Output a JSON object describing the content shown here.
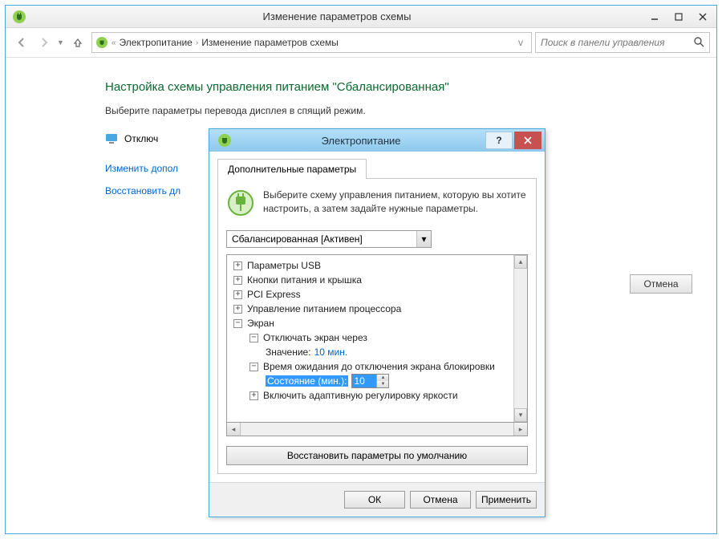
{
  "window": {
    "title": "Изменение параметров схемы",
    "breadcrumb": {
      "p1": "Электропитание",
      "p2": "Изменение параметров схемы"
    },
    "search_placeholder": "Поиск в панели управления"
  },
  "page": {
    "heading": "Настройка схемы управления питанием \"Сбалансированная\"",
    "subtext": "Выберите параметры перевода дисплея в спящий режим.",
    "opt_display_off": "Отключ",
    "link_advanced": "Изменить допол",
    "link_restore": "Восстановить дл",
    "buttons": {
      "cancel": "Отмена"
    }
  },
  "dialog": {
    "title": "Электропитание",
    "tab": "Дополнительные параметры",
    "intro": "Выберите схему управления питанием, которую вы хотите настроить, а затем задайте нужные параметры.",
    "scheme": "Сбалансированная [Активен]",
    "tree": {
      "usb": "Параметры USB",
      "buttons_lid": "Кнопки питания и крышка",
      "pci": "PCI Express",
      "cpu": "Управление питанием процессора",
      "display": "Экран",
      "display_off": "Отключать экран через",
      "display_off_value_label": "Значение:",
      "display_off_value": "10 мин.",
      "lock_timeout": "Время ожидания до отключения экрана блокировки",
      "state_label": "Состояние (мин.):",
      "state_value": "10",
      "adaptive": "Включить адаптивную регулировку яркости"
    },
    "restore_defaults": "Восстановить параметры по умолчанию",
    "footer": {
      "ok": "ОК",
      "cancel": "Отмена",
      "apply": "Применить"
    }
  }
}
